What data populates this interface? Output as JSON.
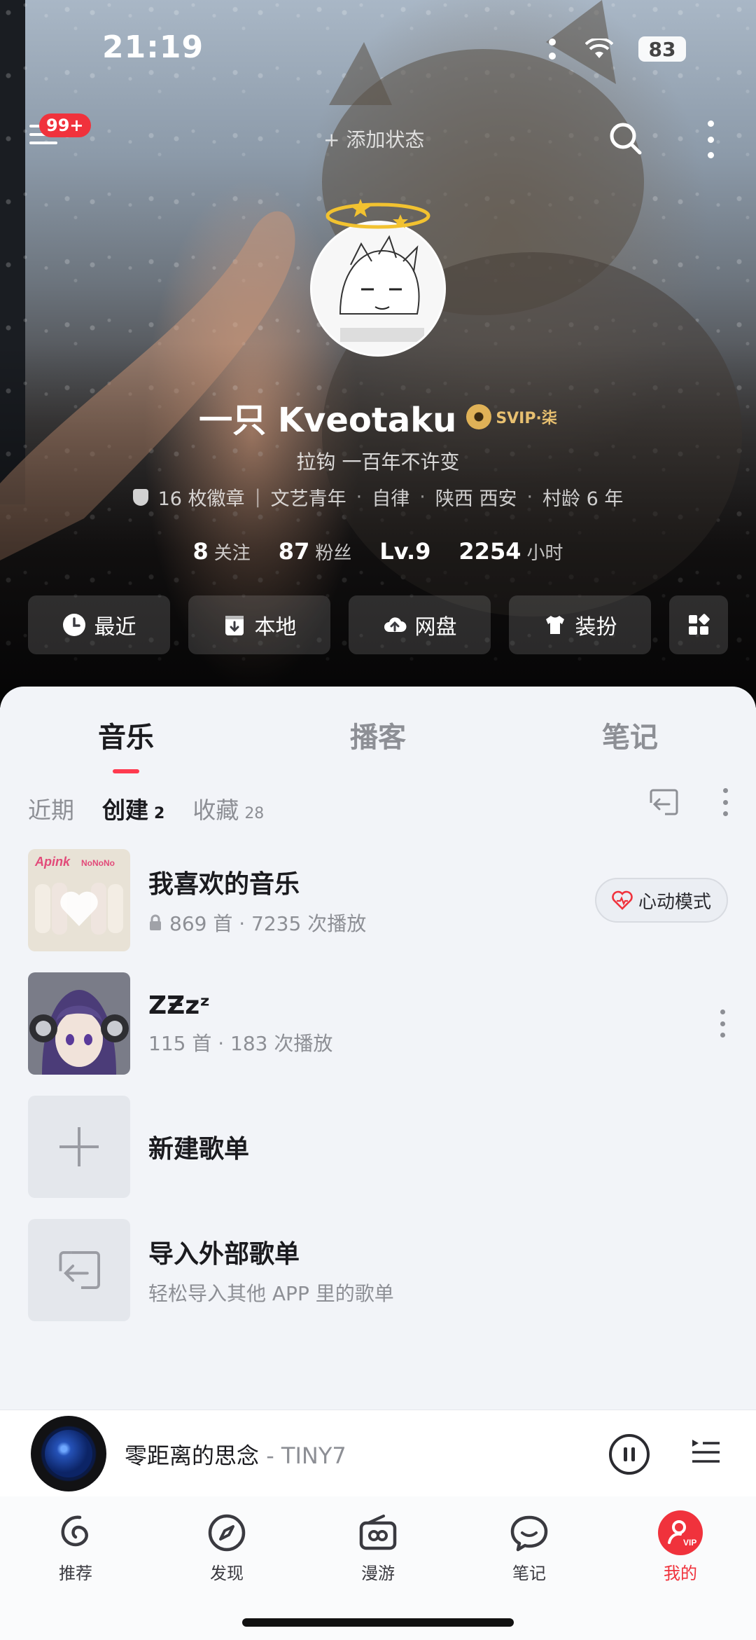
{
  "status_bar": {
    "time": "21:19",
    "battery": "83"
  },
  "top_bar": {
    "notification_badge": "99+",
    "add_status": "+ 添加状态"
  },
  "profile": {
    "username": "一只 Kveotaku",
    "vip_label": "SVIP·柒",
    "signature": "拉钩 一百年不许变",
    "tags": [
      "16 枚徽章",
      "文艺青年",
      "自律",
      "陕西 西安",
      "村龄 6 年"
    ],
    "stats": [
      {
        "value": "8",
        "unit": "关注"
      },
      {
        "value": "87",
        "unit": "粉丝"
      },
      {
        "value": "Lv.9",
        "unit": ""
      },
      {
        "value": "2254",
        "unit": "小时"
      }
    ]
  },
  "quick_actions": [
    {
      "label": "最近",
      "icon": "clock-icon"
    },
    {
      "label": "本地",
      "icon": "download-icon"
    },
    {
      "label": "网盘",
      "icon": "cloud-upload-icon"
    },
    {
      "label": "装扮",
      "icon": "shirt-icon"
    },
    {
      "label": "",
      "icon": "grid-icon"
    }
  ],
  "main_tabs": [
    {
      "label": "音乐",
      "active": true
    },
    {
      "label": "播客",
      "active": false
    },
    {
      "label": "笔记",
      "active": false
    }
  ],
  "sub_tabs": [
    {
      "label": "近期",
      "count": ""
    },
    {
      "label": "创建",
      "count": "2"
    },
    {
      "label": "收藏",
      "count": "28"
    }
  ],
  "playlists": [
    {
      "title": "我喜欢的音乐",
      "meta": "869 首 · 7235 次播放",
      "locked": true,
      "action": "心动模式"
    },
    {
      "title": "ZƵzᶻ",
      "meta": "115 首 · 183 次播放",
      "locked": false
    },
    {
      "title": "新建歌单",
      "meta": ""
    },
    {
      "title": "导入外部歌单",
      "meta": "轻松导入其他 APP 里的歌单"
    }
  ],
  "now_playing": {
    "title": "零距离的思念",
    "artist": " - TINY7"
  },
  "bottom_nav": [
    {
      "label": "推荐",
      "icon": "recommend-icon",
      "active": false
    },
    {
      "label": "发现",
      "icon": "compass-icon",
      "active": false
    },
    {
      "label": "漫游",
      "icon": "radio-icon",
      "active": false
    },
    {
      "label": "笔记",
      "icon": "chat-icon",
      "active": false
    },
    {
      "label": "我的",
      "icon": "profile-icon",
      "active": true
    }
  ],
  "colors": {
    "accent": "#f0323c",
    "tab_indicator": "#ff3a4f",
    "sheet_bg": "#f2f4f8"
  }
}
